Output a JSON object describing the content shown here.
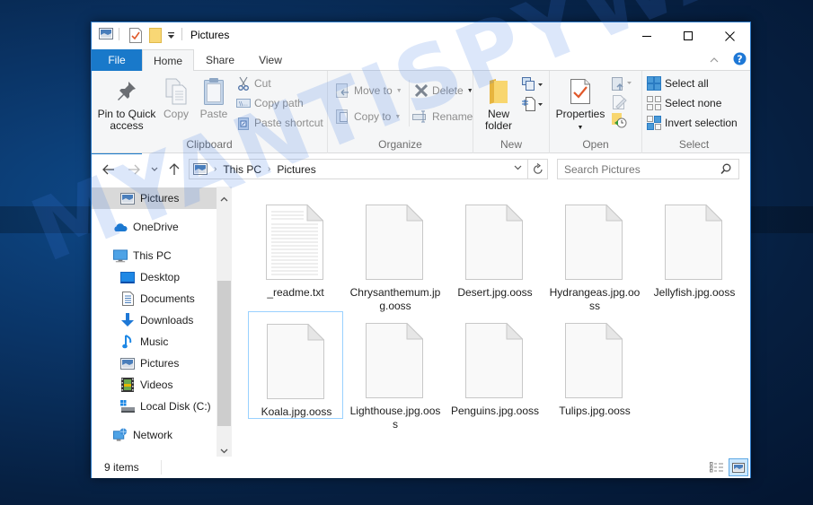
{
  "window": {
    "title": "Pictures",
    "controls": {
      "minimize": "minimize",
      "maximize": "maximize",
      "close": "close"
    }
  },
  "ribbon_tabs": [
    {
      "label": "File",
      "active": false
    },
    {
      "label": "Home",
      "active": true
    },
    {
      "label": "Share",
      "active": false
    },
    {
      "label": "View",
      "active": false
    }
  ],
  "ribbon": {
    "clipboard": {
      "label": "Clipboard",
      "pin": "Pin to Quick access",
      "pin_line1": "Pin to Quick",
      "pin_line2": "access",
      "copy": "Copy",
      "paste": "Paste",
      "cut": "Cut",
      "copy_path": "Copy path",
      "paste_shortcut": "Paste shortcut"
    },
    "organize": {
      "label": "Organize",
      "move_to": "Move to",
      "copy_to": "Copy to",
      "delete": "Delete",
      "rename": "Rename"
    },
    "new": {
      "label": "New",
      "new_folder_line1": "New",
      "new_folder_line2": "folder"
    },
    "open": {
      "label": "Open",
      "properties": "Properties"
    },
    "select": {
      "label": "Select",
      "select_all": "Select all",
      "select_none": "Select none",
      "invert_selection": "Invert selection"
    }
  },
  "address_bar": {
    "crumbs": [
      "This PC",
      "Pictures"
    ],
    "search_placeholder": "Search Pictures"
  },
  "nav_pane": {
    "items": [
      {
        "label": "Pictures",
        "icon": "pictures-icon",
        "selected": true
      },
      {
        "label": "OneDrive",
        "icon": "onedrive-icon"
      },
      {
        "label": "This PC",
        "icon": "this-pc-icon"
      },
      {
        "label": "Desktop",
        "icon": "desktop-icon"
      },
      {
        "label": "Documents",
        "icon": "documents-icon"
      },
      {
        "label": "Downloads",
        "icon": "downloads-icon"
      },
      {
        "label": "Music",
        "icon": "music-icon"
      },
      {
        "label": "Pictures",
        "icon": "pictures-icon"
      },
      {
        "label": "Videos",
        "icon": "videos-icon"
      },
      {
        "label": "Local Disk (C:)",
        "icon": "local-disk-icon"
      },
      {
        "label": "Network",
        "icon": "network-icon"
      }
    ]
  },
  "files": [
    {
      "name": "_readme.txt",
      "type": "text"
    },
    {
      "name": "Chrysanthemum.jpg.ooss",
      "type": "blank"
    },
    {
      "name": "Desert.jpg.ooss",
      "type": "blank"
    },
    {
      "name": "Hydrangeas.jpg.ooss",
      "type": "blank"
    },
    {
      "name": "Jellyfish.jpg.ooss",
      "type": "blank"
    },
    {
      "name": "Koala.jpg.ooss",
      "type": "blank",
      "focused": true
    },
    {
      "name": "Lighthouse.jpg.ooss",
      "type": "blank"
    },
    {
      "name": "Penguins.jpg.ooss",
      "type": "blank"
    },
    {
      "name": "Tulips.jpg.ooss",
      "type": "blank"
    }
  ],
  "status_bar": {
    "item_count": "9 items"
  },
  "watermark": "MYANTISPYWARE.COM",
  "colors": {
    "accent": "#1979ca",
    "window_border": "#2b79c7",
    "selection": "#d9d9d9",
    "focus_border": "#99d1ff"
  }
}
